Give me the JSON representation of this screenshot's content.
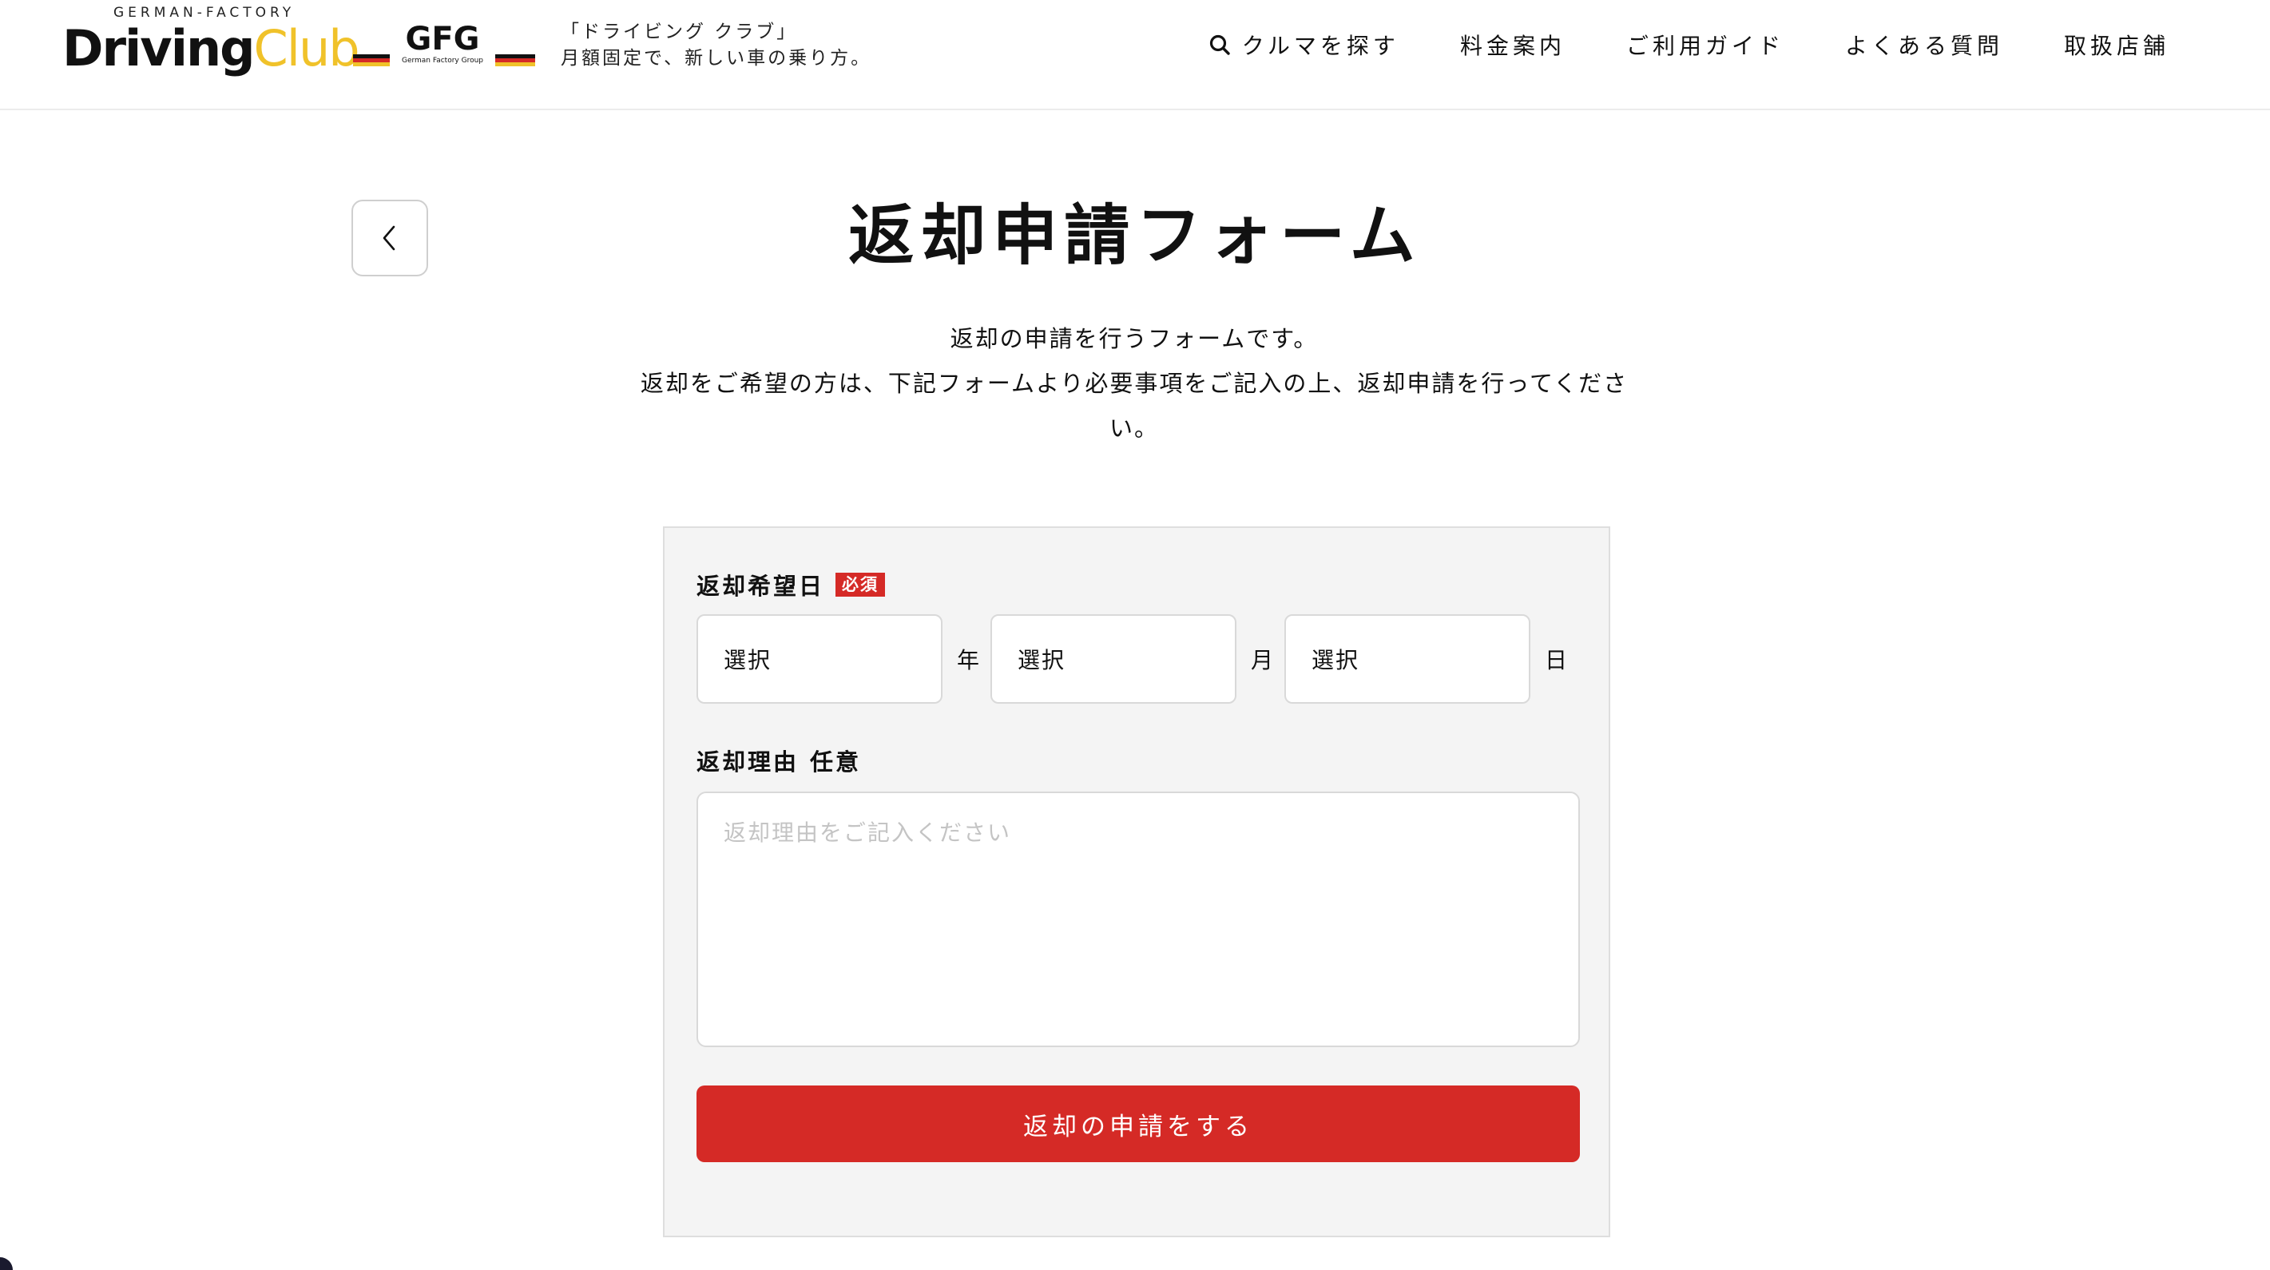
{
  "header": {
    "logo": {
      "sub": "GERMAN-FACTORY",
      "word1": "Driving",
      "word2": "Club",
      "gfg_text": "GFG",
      "gfg_sub": "German Factory Group"
    },
    "tagline_line1": "「ドライビング クラブ」",
    "tagline_line2": "月額固定で、新しい車の乗り方。",
    "nav": [
      {
        "label": "クルマを探す",
        "icon": "search-icon"
      },
      {
        "label": "料金案内"
      },
      {
        "label": "ご利用ガイド"
      },
      {
        "label": "よくある質問"
      },
      {
        "label": "取扱店舗"
      }
    ]
  },
  "page": {
    "back_icon": "chevron-left-icon",
    "title": "返却申請フォーム",
    "desc_line1": "返却の申請を行うフォームです。",
    "desc_line2": "返却をご希望の方は、下記フォームより必要事項をご記入の上、返却申請を行ってくださ",
    "desc_line3": "い。"
  },
  "form": {
    "date_label": "返却希望日",
    "required_badge": "必須",
    "year_select": "選択",
    "year_unit": "年",
    "month_select": "選択",
    "month_unit": "月",
    "day_select": "選択",
    "day_unit": "日",
    "reason_label": "返却理由",
    "optional_tag": "任意",
    "reason_placeholder": "返却理由をご記入ください",
    "submit_label": "返却の申請をする"
  },
  "colors": {
    "accent_red": "#d52a26",
    "logo_yellow": "#f0c22a",
    "form_bg": "#f4f4f4"
  }
}
